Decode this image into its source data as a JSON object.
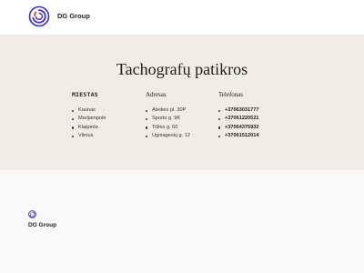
{
  "header": {
    "brand": "DG Group",
    "logo_icon": "dg-group-logo-icon"
  },
  "main": {
    "title": "Tachografų patikros",
    "columns": {
      "cities": {
        "heading": "MIESTAS",
        "items": [
          "Kaunas",
          "Marijampolė",
          "Klaipėda",
          "Vilnius"
        ]
      },
      "addresses": {
        "heading": "Adresas",
        "items": [
          "Ateities pl. 30P",
          "Sporto g. 9K",
          "Tilžės g. 60",
          "Ugniagesių g. 12"
        ]
      },
      "phones": {
        "heading": "Telefonas",
        "items": [
          "+37063031777",
          "+37061220521",
          "+37064375932",
          "+37061512014"
        ]
      }
    }
  },
  "footer": {
    "brand": "DG Group",
    "logo_icon": "dg-group-logo-icon"
  },
  "colors": {
    "band_background": "#f1ede6",
    "logo_blue": "#2d2fd6",
    "logo_red": "#e0423a",
    "page_background": "#faf9f8"
  }
}
